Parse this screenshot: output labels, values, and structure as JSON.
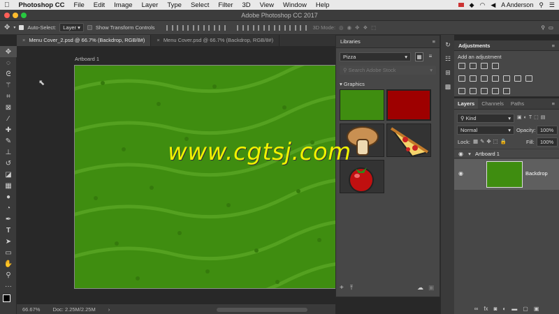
{
  "menubar": {
    "apple": "",
    "app_name": "Photoshop CC",
    "items": [
      "File",
      "Edit",
      "Image",
      "Layer",
      "Type",
      "Select",
      "Filter",
      "3D",
      "View",
      "Window",
      "Help"
    ],
    "user": "A Anderson"
  },
  "window": {
    "title": "Adobe Photoshop CC 2017"
  },
  "options": {
    "auto_select_label": "Auto-Select:",
    "auto_select_value": "Layer",
    "show_transform_label": "Show Transform Controls",
    "mode_3d_label": "3D Mode:"
  },
  "doc_tabs": [
    {
      "label": "Menu Cover_2.psd @ 66.7% (Backdrop, RGB/8#)",
      "active": true
    },
    {
      "label": "Menu Cover.psd @ 66.7% (Backdrop, RGB/8#)",
      "active": false
    }
  ],
  "canvas": {
    "artboard_label": "Artboard 1",
    "watermark": "www.cgtsj.com",
    "backdrop_color": "#3f8d10"
  },
  "status": {
    "zoom": "66.67%",
    "doc": "Doc: 2.25M/2.25M",
    "arrow": "›"
  },
  "libraries": {
    "title": "Libraries",
    "library_name": "Pizza",
    "search_placeholder": "Search Adobe Stock",
    "section": "Graphics"
  },
  "adjustments": {
    "title": "Adjustments",
    "subtitle": "Add an adjustment"
  },
  "layers_panel": {
    "tabs": [
      "Layers",
      "Channels",
      "Paths"
    ],
    "filter": "Kind",
    "blend_mode": "Normal",
    "opacity_label": "Opacity:",
    "opacity_value": "100%",
    "lock_label": "Lock:",
    "fill_label": "Fill:",
    "fill_value": "100%",
    "group_name": "Artboard 1",
    "layer_name": "Backdrop"
  },
  "colors": {
    "watermark": "#f2f200",
    "grass_green": "#3f8d10",
    "tomato_red": "#c01010",
    "close_red": "#fe5f57",
    "minimize_yellow": "#febc2e",
    "zoom_green": "#28c840"
  }
}
